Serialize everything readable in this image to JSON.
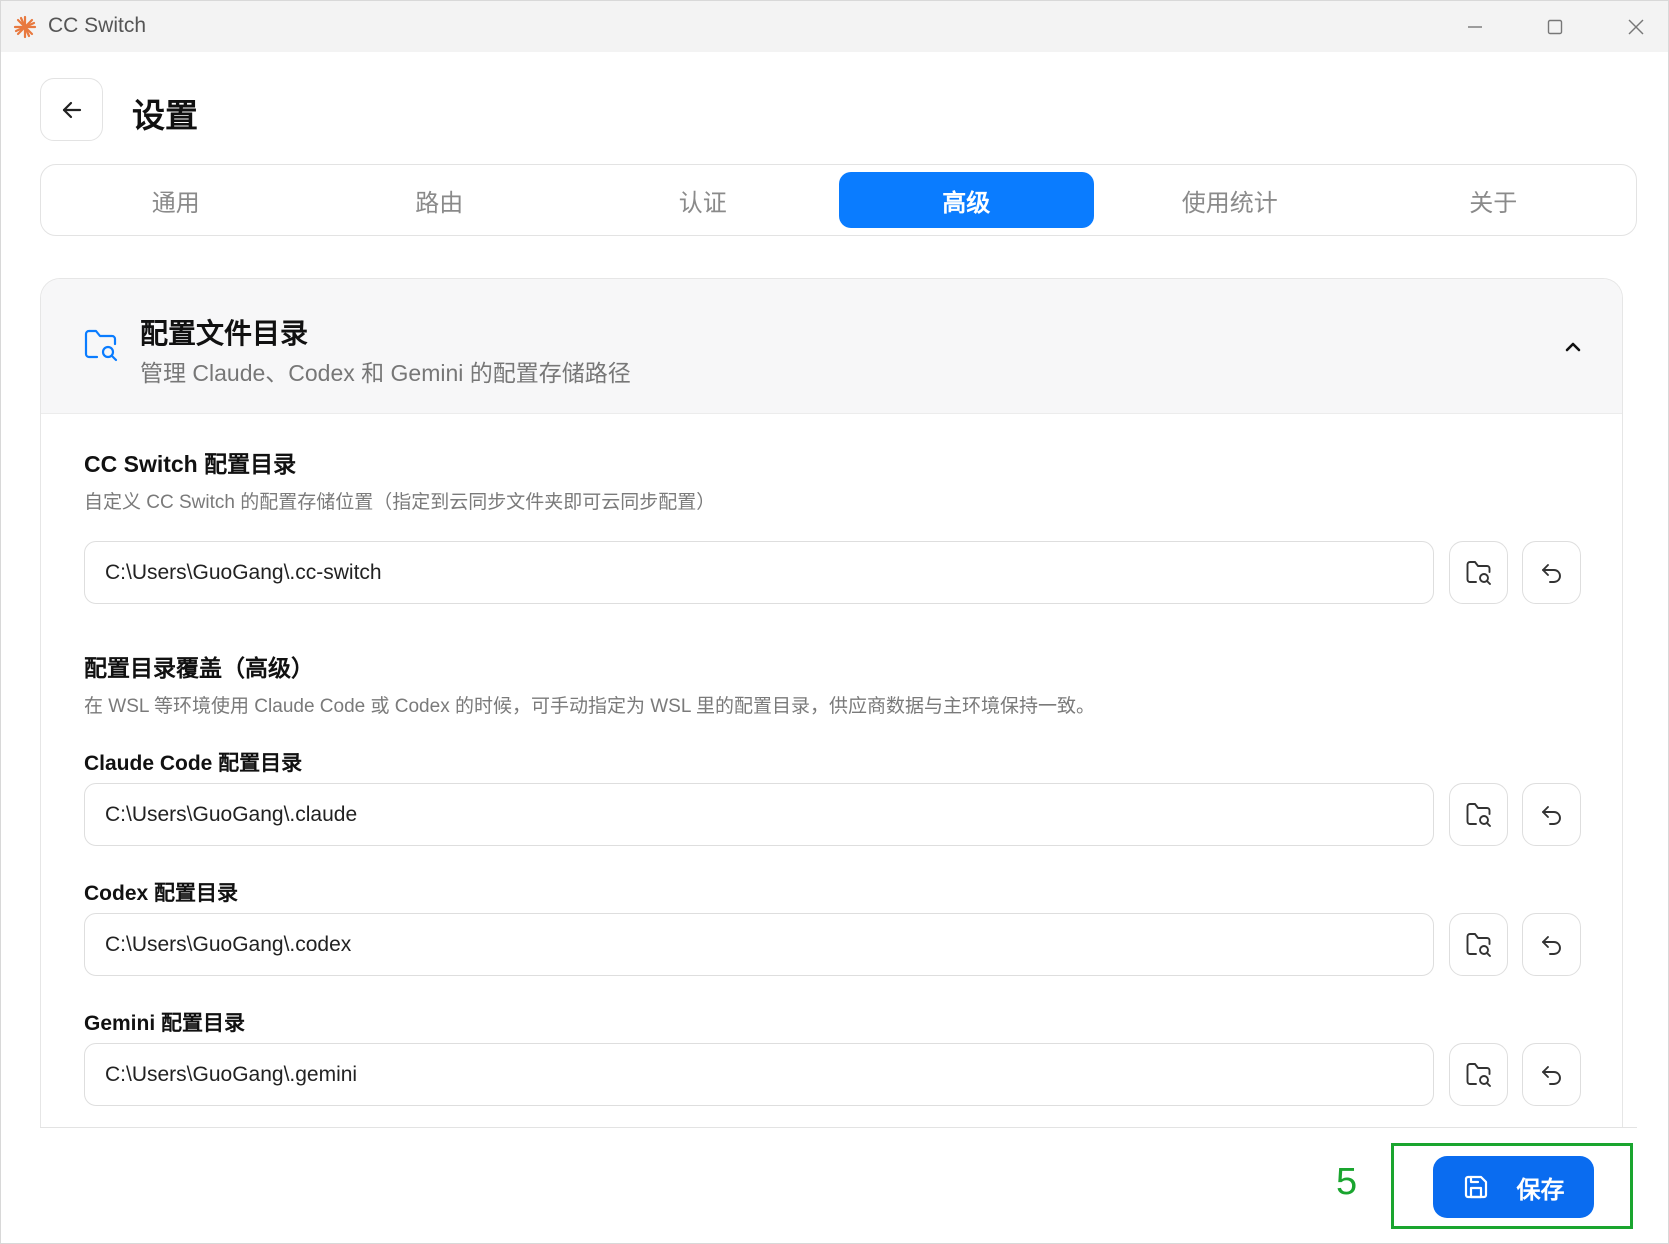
{
  "window": {
    "title": "CC Switch",
    "logo_icon": "starburst-logo-icon",
    "minimize_icon": "minimize-icon",
    "maximize_icon": "maximize-icon",
    "close_icon": "close-icon"
  },
  "header": {
    "back_icon": "arrow-left-icon",
    "title": "设置"
  },
  "tabs": [
    {
      "label": "通用",
      "active": false
    },
    {
      "label": "路由",
      "active": false
    },
    {
      "label": "认证",
      "active": false
    },
    {
      "label": "高级",
      "active": true
    },
    {
      "label": "使用统计",
      "active": false
    },
    {
      "label": "关于",
      "active": false
    }
  ],
  "card": {
    "icon": "folder-search-icon",
    "title": "配置文件目录",
    "subtitle": "管理 Claude、Codex 和 Gemini 的配置存储路径",
    "collapse_icon": "chevron-up-icon"
  },
  "cc_switch_dir": {
    "title": "CC Switch 配置目录",
    "description": "自定义 CC Switch 的配置存储位置（指定到云同步文件夹即可云同步配置）",
    "value": "C:\\Users\\GuoGang\\.cc-switch"
  },
  "override": {
    "title": "配置目录覆盖（高级）",
    "description": "在 WSL 等环境使用 Claude Code 或 Codex 的时候，可手动指定为 WSL 里的配置目录，供应商数据与主环境保持一致。",
    "claude": {
      "label": "Claude Code 配置目录",
      "value": "C:\\Users\\GuoGang\\.claude"
    },
    "codex": {
      "label": "Codex 配置目录",
      "value": "C:\\Users\\GuoGang\\.codex"
    },
    "gemini": {
      "label": "Gemini 配置目录",
      "value": "C:\\Users\\GuoGang\\.gemini"
    }
  },
  "footer": {
    "step_number": "5",
    "save_label": "保存",
    "save_icon": "save-icon"
  },
  "colors": {
    "accent": "#0a7cff",
    "save_button": "#0a6cf0",
    "highlight": "#1aa52f"
  }
}
